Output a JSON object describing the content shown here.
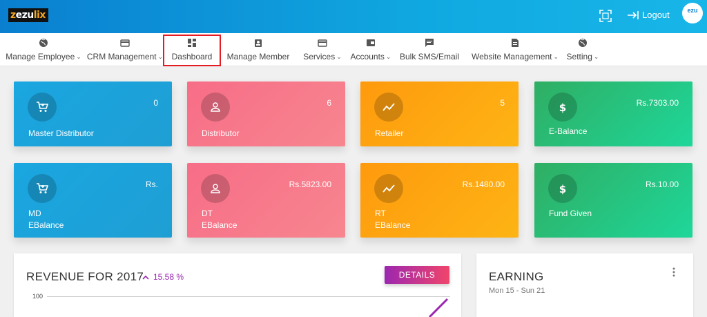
{
  "header": {
    "logo_a": "z",
    "logo_b": "ezu",
    "logo_c": "lix",
    "logout_label": "Logout",
    "avatar_text": "ezu"
  },
  "nav": {
    "items": [
      {
        "label": "Manage Employee",
        "icon": "globe-icon",
        "dropdown": true
      },
      {
        "label": "CRM Management",
        "icon": "card-icon",
        "dropdown": true
      },
      {
        "label": "Dashboard",
        "icon": "dashboard-icon",
        "dropdown": false,
        "highlighted": true
      },
      {
        "label": "Manage Member",
        "icon": "badge-icon",
        "dropdown": false
      },
      {
        "label": "Services",
        "icon": "card-icon",
        "dropdown": true
      },
      {
        "label": "Accounts",
        "icon": "wallet-icon",
        "dropdown": true
      },
      {
        "label": "Bulk SMS/Email",
        "icon": "message-icon",
        "dropdown": false
      },
      {
        "label": "Website Management",
        "icon": "document-icon",
        "dropdown": true
      },
      {
        "label": "Setting",
        "icon": "globe-icon",
        "dropdown": true
      }
    ]
  },
  "cards": [
    {
      "label": "Master Distributor",
      "value": "0",
      "icon": "cart-icon",
      "color": "#1ea4dc"
    },
    {
      "label": "Distributor",
      "value": "6",
      "icon": "user-icon",
      "color": "#f7768c"
    },
    {
      "label": "Retailer",
      "value": "5",
      "icon": "trend-icon",
      "color": "#fea511"
    },
    {
      "label": "E-Balance",
      "value": "Rs.7303.00",
      "icon": "dollar-icon",
      "color": "#27c27d"
    },
    {
      "label_1": "MD",
      "label_2": "EBalance",
      "value": "Rs.",
      "icon": "cart-icon",
      "color": "#1ea4dc"
    },
    {
      "label_1": "DT",
      "label_2": "EBalance",
      "value": "Rs.5823.00",
      "icon": "user-icon",
      "color": "#f7768c"
    },
    {
      "label_1": "RT",
      "label_2": "EBalance",
      "value": "Rs.1480.00",
      "icon": "trend-icon",
      "color": "#fea511"
    },
    {
      "label": "Fund Given",
      "value": "Rs.10.00",
      "icon": "dollar-icon",
      "color": "#27c27d"
    }
  ],
  "revenue": {
    "title": "REVENUE FOR 2017",
    "change": "15.58 %",
    "details_label": "DETAILS",
    "axis_top": "100"
  },
  "earning": {
    "title": "EARNING",
    "range": "Mon 15 - Sun 21"
  },
  "colors": {
    "accent_purple": "#9c27b0",
    "highlight_red": "#e41b23"
  }
}
